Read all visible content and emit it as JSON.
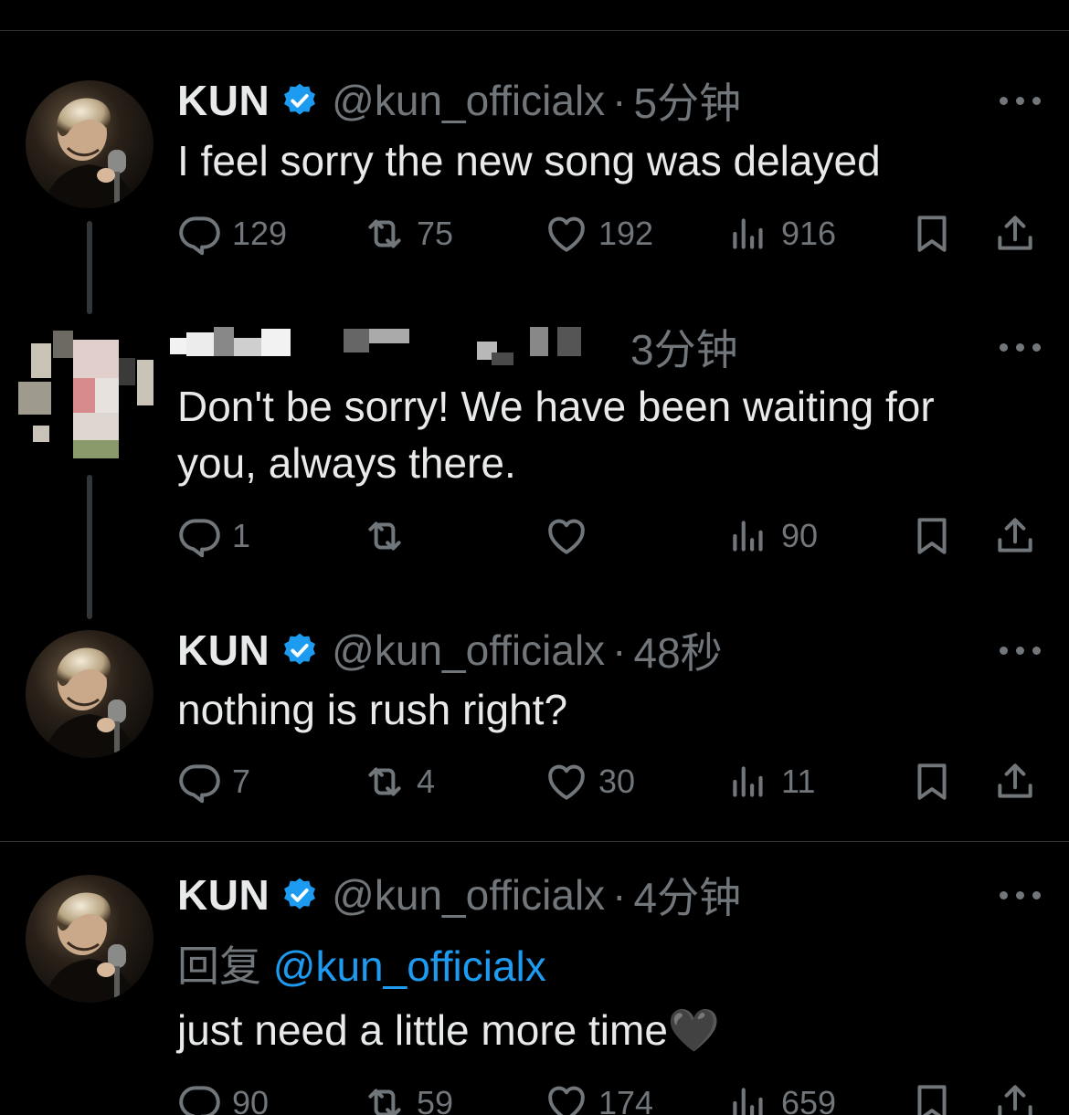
{
  "tweets": [
    {
      "name": "KUN",
      "handle": "@kun_officialx",
      "time": "5分钟",
      "text": "I feel sorry the new song was delayed",
      "stats": {
        "replies": "129",
        "retweets": "75",
        "likes": "192",
        "views": "916"
      }
    },
    {
      "name": "",
      "handle": "",
      "time": "3分钟",
      "text": "Don't be sorry! We have been waiting for you, always there.",
      "stats": {
        "replies": "1",
        "retweets": "",
        "likes": "",
        "views": "90"
      }
    },
    {
      "name": "KUN",
      "handle": "@kun_officialx",
      "time": "48秒",
      "text": "nothing is rush right?",
      "stats": {
        "replies": "7",
        "retweets": "4",
        "likes": "30",
        "views": "11"
      }
    },
    {
      "name": "KUN",
      "handle": "@kun_officialx",
      "time": "4分钟",
      "reply_prefix": "回复",
      "reply_mention": "@kun_officialx",
      "text": "just need a little more time🖤",
      "stats": {
        "replies": "90",
        "retweets": "59",
        "likes": "174",
        "views": "659"
      }
    }
  ],
  "separator": "·",
  "icons": {
    "reply": "reply-icon",
    "retweet": "retweet-icon",
    "like": "heart-icon",
    "views": "views-icon",
    "bookmark": "bookmark-icon",
    "share": "share-icon",
    "verified": "verified-badge-icon",
    "more": "more-icon"
  },
  "colors": {
    "background": "#000000",
    "text": "#e7e9ea",
    "muted": "#71767b",
    "accent": "#1d9bf0",
    "divider": "#2f3336"
  }
}
